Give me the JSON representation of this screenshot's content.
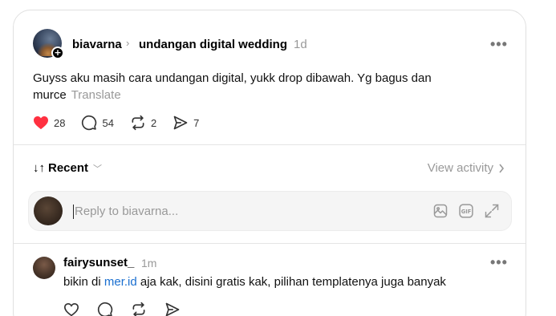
{
  "post": {
    "username": "biavarna",
    "crumb_separator": "›",
    "topic": "undangan digital wedding",
    "time": "1d",
    "follow_badge": "+",
    "text_line1": "Guyss aku masih cara undangan digital, yukk drop dibawah. Yg bagus dan",
    "text_line2": "murce",
    "translate_label": "Translate",
    "likes": "28",
    "comments": "54",
    "reposts": "2",
    "shares": "7",
    "like_color": "#ff3040"
  },
  "sort": {
    "label": "Recent",
    "icon": "sort-arrows-icon",
    "view_activity": "View activity"
  },
  "reply": {
    "placeholder": "Reply to biavarna...",
    "tools": [
      "image-icon",
      "gif-icon",
      "expand-icon"
    ]
  },
  "comment": {
    "username": "fairysunset_",
    "time": "1m",
    "text_before": "bikin di ",
    "link": "mer.id",
    "text_after": " aja kak, disini gratis kak, pilihan templatenya juga banyak",
    "link_color": "#1a6fd0"
  }
}
